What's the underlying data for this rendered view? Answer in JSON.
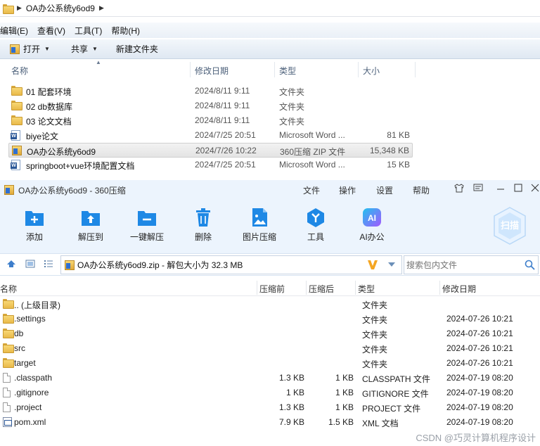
{
  "explorer": {
    "breadcrumb": "OA办公系统y6od9",
    "menu": [
      "编辑(E)",
      "查看(V)",
      "工具(T)",
      "帮助(H)"
    ],
    "toolbar": {
      "open": "打开",
      "share": "共享",
      "new_folder": "新建文件夹"
    },
    "columns": {
      "name": "名称",
      "date": "修改日期",
      "type": "类型",
      "size": "大小"
    },
    "rows": [
      {
        "icon": "folder-icon",
        "name": "01 配套环境",
        "date": "2024/8/11 9:11",
        "type": "文件夹",
        "size": ""
      },
      {
        "icon": "folder-icon",
        "name": "02 db数据库",
        "date": "2024/8/11 9:11",
        "type": "文件夹",
        "size": ""
      },
      {
        "icon": "folder-icon",
        "name": "03 论文文档",
        "date": "2024/8/11 9:11",
        "type": "文件夹",
        "size": ""
      },
      {
        "icon": "word-doc-icon",
        "name": "biye论文",
        "date": "2024/7/25 20:51",
        "type": "Microsoft Word ...",
        "size": "81 KB"
      },
      {
        "icon": "zip-archive-icon",
        "name": "OA办公系统y6od9",
        "date": "2024/7/26 10:22",
        "type": "360压缩 ZIP 文件",
        "size": "15,348 KB"
      },
      {
        "icon": "word-doc-icon",
        "name": "springboot+vue环境配置文档",
        "date": "2024/7/25 20:51",
        "type": "Microsoft Word ...",
        "size": "15 KB"
      }
    ]
  },
  "zip": {
    "title": "OA办公系统y6od9 - 360压缩",
    "menu": {
      "file": "文件",
      "operate": "操作",
      "settings": "设置",
      "help": "帮助"
    },
    "tools": {
      "add": "添加",
      "extract_to": "解压到",
      "one_click": "一键解压",
      "delete": "删除",
      "image_compress": "图片压缩",
      "tools": "工具",
      "ai_office": "AI办公"
    },
    "scan": "扫描",
    "ai_badge": "AI",
    "path": "OA办公系统y6od9.zip - 解包大小为 32.3 MB",
    "search_placeholder": "搜索包内文件",
    "columns": {
      "name": "名称",
      "before": "压缩前",
      "after": "压缩后",
      "type": "类型",
      "date": "修改日期"
    },
    "rows": [
      {
        "icon": "folder-icon",
        "name": ".. (上级目录)",
        "before": "",
        "after": "",
        "type": "文件夹",
        "date": ""
      },
      {
        "icon": "folder-icon",
        "name": ".settings",
        "before": "",
        "after": "",
        "type": "文件夹",
        "date": "2024-07-26 10:21"
      },
      {
        "icon": "folder-icon",
        "name": "db",
        "before": "",
        "after": "",
        "type": "文件夹",
        "date": "2024-07-26 10:21"
      },
      {
        "icon": "folder-icon",
        "name": "src",
        "before": "",
        "after": "",
        "type": "文件夹",
        "date": "2024-07-26 10:21"
      },
      {
        "icon": "folder-icon",
        "name": "target",
        "before": "",
        "after": "",
        "type": "文件夹",
        "date": "2024-07-26 10:21"
      },
      {
        "icon": "file-icon",
        "name": ".classpath",
        "before": "1.3 KB",
        "after": "1 KB",
        "type": "CLASSPATH 文件",
        "date": "2024-07-19 08:20"
      },
      {
        "icon": "file-icon",
        "name": ".gitignore",
        "before": "1 KB",
        "after": "1 KB",
        "type": "GITIGNORE 文件",
        "date": "2024-07-19 08:20"
      },
      {
        "icon": "file-icon",
        "name": ".project",
        "before": "1.3 KB",
        "after": "1 KB",
        "type": "PROJECT 文件",
        "date": "2024-07-19 08:20"
      },
      {
        "icon": "xml-file-icon",
        "name": "pom.xml",
        "before": "7.9 KB",
        "after": "1.5 KB",
        "type": "XML 文档",
        "date": "2024-07-19 08:20"
      }
    ]
  },
  "watermark": "CSDN @巧灵计算机程序设计",
  "colors": {
    "accent_blue": "#1e88e5",
    "folder_yellow": "#f4c94e",
    "tool_bg": "#ecf4fd",
    "search_orange": "#f5a623"
  }
}
